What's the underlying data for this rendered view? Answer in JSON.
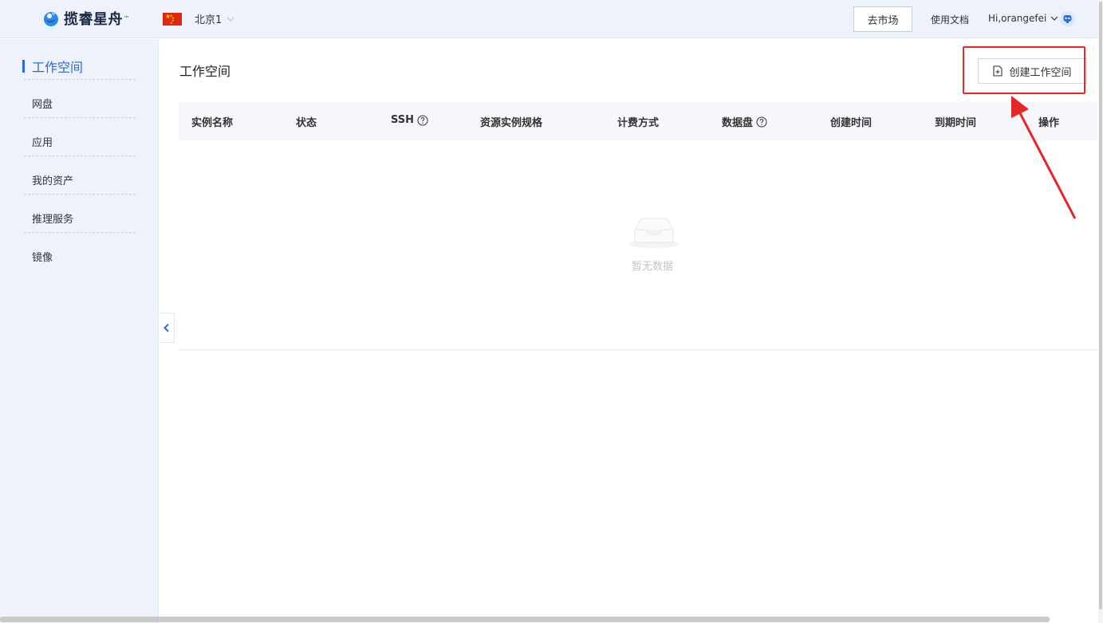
{
  "header": {
    "logo_text": "揽睿星舟",
    "logo_tm": "™",
    "region": "北京1",
    "market_button": "去市场",
    "docs_link": "使用文档",
    "user_greeting": "Hi,orangefei",
    "icons": {
      "logo": "logo-icon",
      "flag": "china-flag-icon",
      "region_chevron": "chevron-down-icon",
      "user_chevron": "chevron-down-icon",
      "avatar": "robot-avatar-icon"
    }
  },
  "sidebar": {
    "items": [
      {
        "label": "工作空间",
        "active": true
      },
      {
        "label": "网盘",
        "active": false
      },
      {
        "label": "应用",
        "active": false
      },
      {
        "label": "我的资产",
        "active": false
      },
      {
        "label": "推理服务",
        "active": false
      },
      {
        "label": "镜像",
        "active": false
      }
    ],
    "collapse_icon": "chevron-left-icon"
  },
  "main": {
    "title": "工作空间",
    "create_button": "创建工作空间",
    "table": {
      "columns": [
        "实例名称",
        "状态",
        "SSH",
        "资源实例规格",
        "计费方式",
        "数据盘",
        "创建时间",
        "到期时间",
        "操作"
      ],
      "rows": [],
      "empty_text": "暂无数据"
    }
  },
  "colors": {
    "accent": "#2b6bd6",
    "highlight": "#e8262a",
    "header_bg": "#eef2fa"
  }
}
